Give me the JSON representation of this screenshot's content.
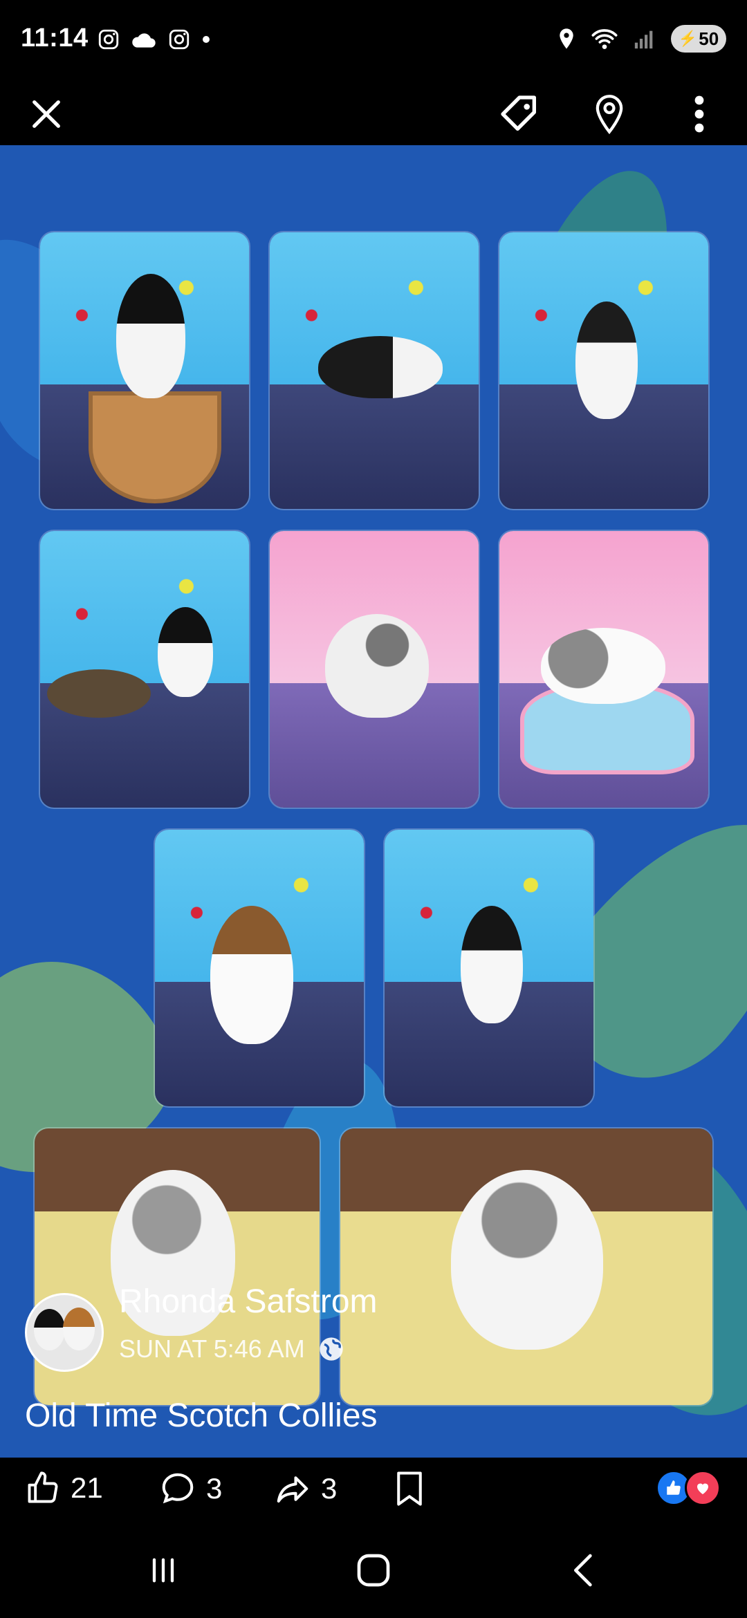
{
  "status": {
    "time": "11:14",
    "battery": "50",
    "left_icons": [
      "instagram-icon",
      "cloud-icon",
      "instagram-icon",
      "dot-icon"
    ],
    "right_icons": [
      "location-icon",
      "wifi-icon",
      "signal-icon",
      "battery-icon"
    ]
  },
  "topbar": {
    "icons": [
      "close-icon",
      "tag-icon",
      "location-pin-icon",
      "more-vertical-icon"
    ]
  },
  "post": {
    "author": "Rhonda Safstrom",
    "timestamp": "SUN AT 5:46 AM",
    "privacy_icon": "globe-icon",
    "caption": "Old Time Scotch Collies"
  },
  "actions": {
    "likes": "21",
    "comments": "3",
    "shares": "3",
    "reactions": [
      "like-reaction-icon",
      "love-reaction-icon"
    ]
  },
  "colors": {
    "photo_bg": "#1f58b3",
    "like_blue": "#1877f2",
    "love_red": "#f33e58"
  },
  "navbar": {
    "buttons": [
      "recent-apps-icon",
      "home-icon",
      "back-icon"
    ]
  }
}
